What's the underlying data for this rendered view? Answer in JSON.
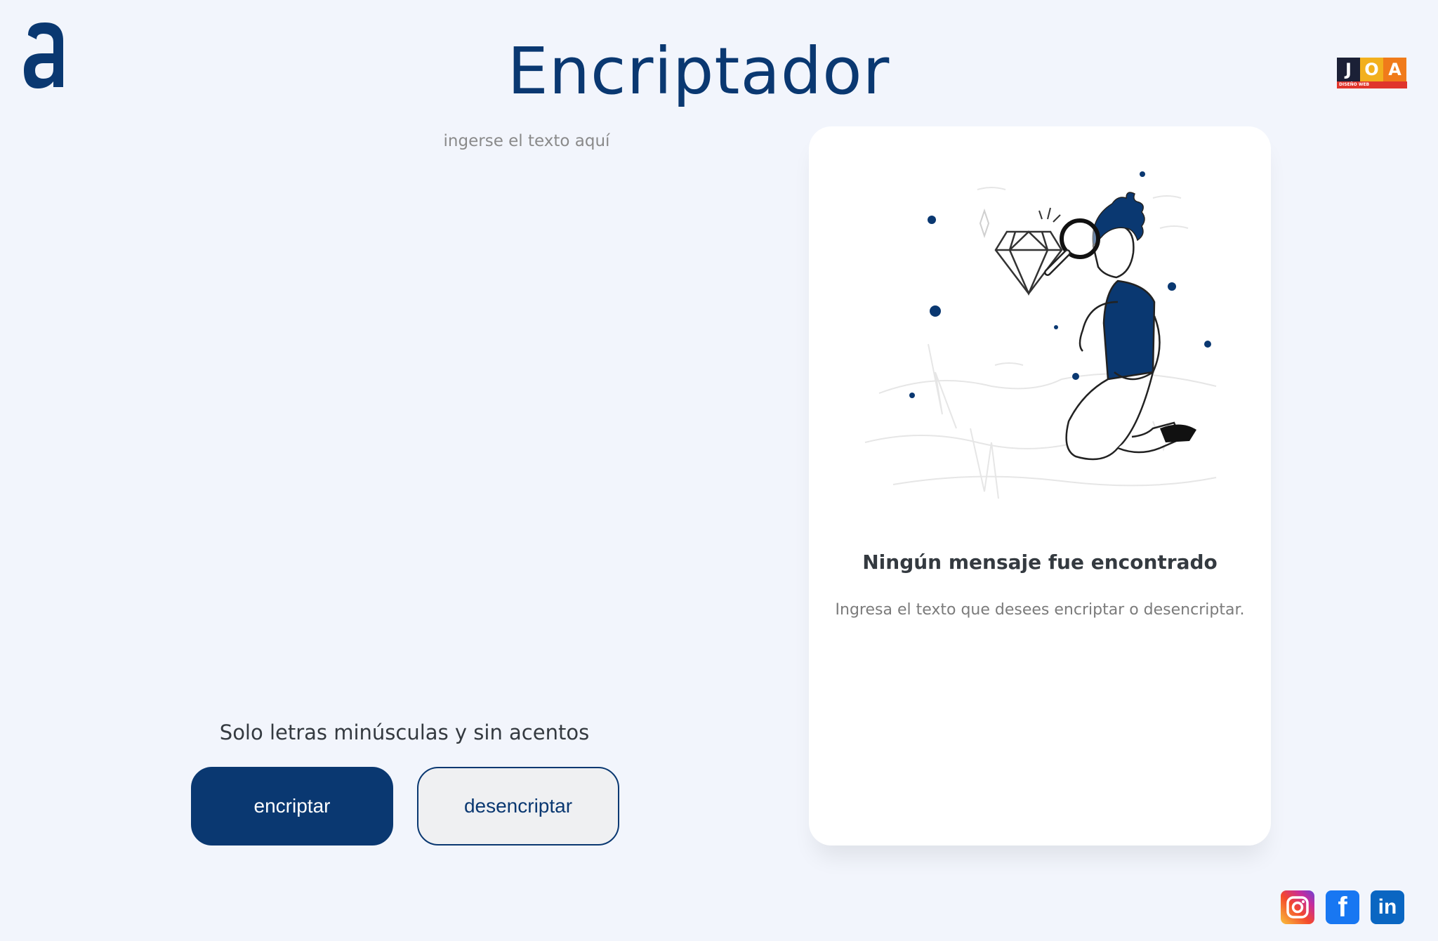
{
  "header": {
    "title": "Encriptador",
    "brand_logo_icon": "letter-a-logo-icon",
    "joa_logo": {
      "letters": [
        "J",
        "O",
        "A"
      ],
      "subtitle": "DISEÑO WEB"
    }
  },
  "input": {
    "placeholder": "ingerse el texto aquí",
    "value": ""
  },
  "hint": "Solo letras minúsculas y sin acentos",
  "buttons": {
    "encrypt_label": "encriptar",
    "decrypt_label": "desencriptar"
  },
  "result": {
    "illustration_icon": "person-with-magnifying-glass-and-diamond-illustration",
    "title": "Ningún mensaje fue encontrado",
    "text": "Ingresa el texto que desees encriptar o desencriptar."
  },
  "socials": [
    {
      "name": "instagram-icon"
    },
    {
      "name": "facebook-icon",
      "glyph": "f"
    },
    {
      "name": "linkedin-icon",
      "glyph": "in"
    }
  ],
  "colors": {
    "primary": "#0a3871",
    "background": "#f2f5fc",
    "card": "#ffffff",
    "secondary_button": "#eff0f2"
  }
}
